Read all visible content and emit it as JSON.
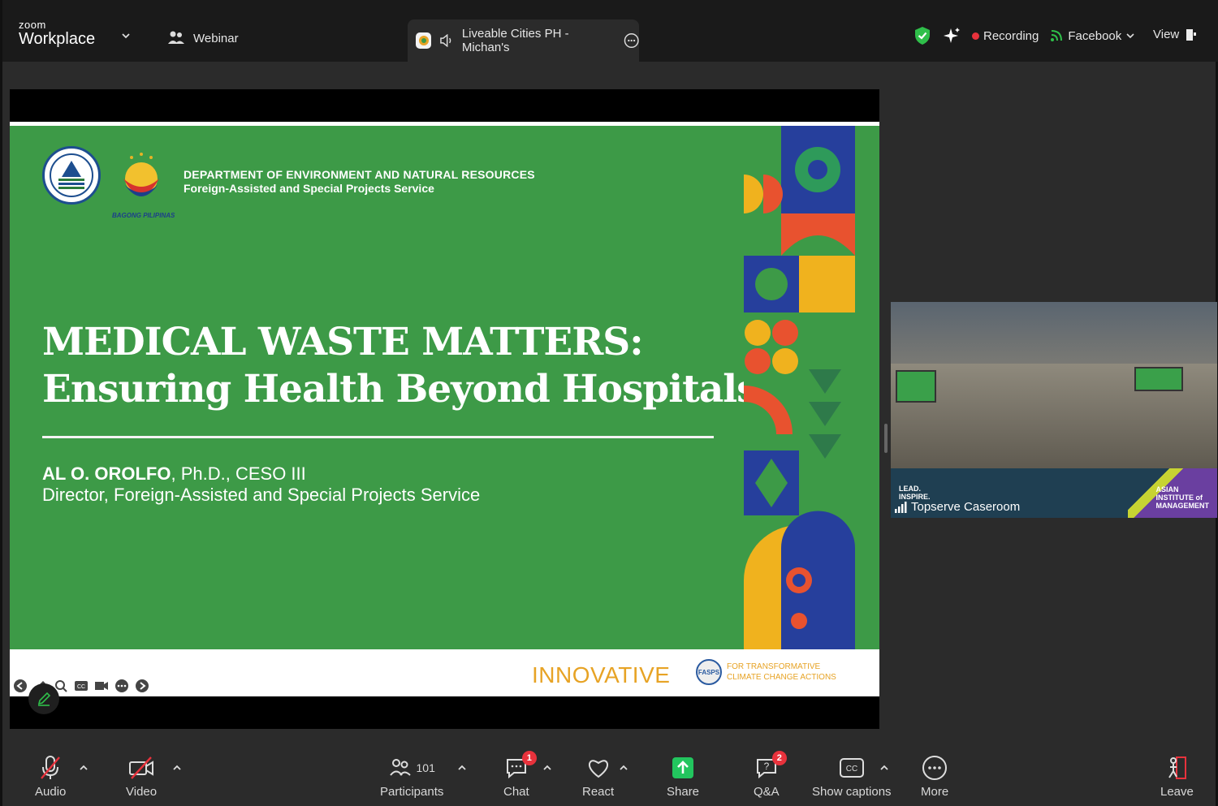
{
  "app": {
    "brand_small": "zoom",
    "brand_large": "Workplace",
    "webinar_label": "Webinar"
  },
  "tab": {
    "title": "Liveable Cities PH - Michan's"
  },
  "status": {
    "recording_label": "Recording",
    "stream_label": "Facebook",
    "view_label": "View"
  },
  "slide": {
    "dept_line1": "DEPARTMENT OF ENVIRONMENT AND NATURAL RESOURCES",
    "dept_line2": "Foreign-Assisted and Special Projects Service",
    "bagong_label": "BAGONG PILIPINAS",
    "title_line1": "MEDICAL WASTE MATTERS:",
    "title_line2": "Ensuring Health Beyond Hospitals",
    "speaker_name": "AL O. OROLFO",
    "speaker_creds": ", Ph.D., CESO III",
    "speaker_role": "Director, Foreign-Assisted and Special Projects Service",
    "footer_word": "INNOVATIVE",
    "fasps_abbr": "FASPS",
    "fasps_line1": "FOR TRANSFORMATIVE",
    "fasps_line2": "CLIMATE CHANGE ACTIONS"
  },
  "video": {
    "participant_name": "Topserve Caseroom",
    "lead_line1": "LEAD.",
    "lead_line2": "INSPIRE.",
    "aim_line1": "ASIAN",
    "aim_line2": "INSTITUTE of",
    "aim_line3": "MANAGEMENT"
  },
  "toolbar": {
    "audio": "Audio",
    "video": "Video",
    "participants": "Participants",
    "participant_count": "101",
    "chat": "Chat",
    "chat_badge": "1",
    "react": "React",
    "share": "Share",
    "qa": "Q&A",
    "qa_badge": "2",
    "captions": "Show captions",
    "more": "More",
    "leave": "Leave"
  },
  "colors": {
    "slide_green": "#3d9a47",
    "accent_orange": "#e7a325",
    "record_red": "#e8323c",
    "share_green": "#22c55e"
  }
}
